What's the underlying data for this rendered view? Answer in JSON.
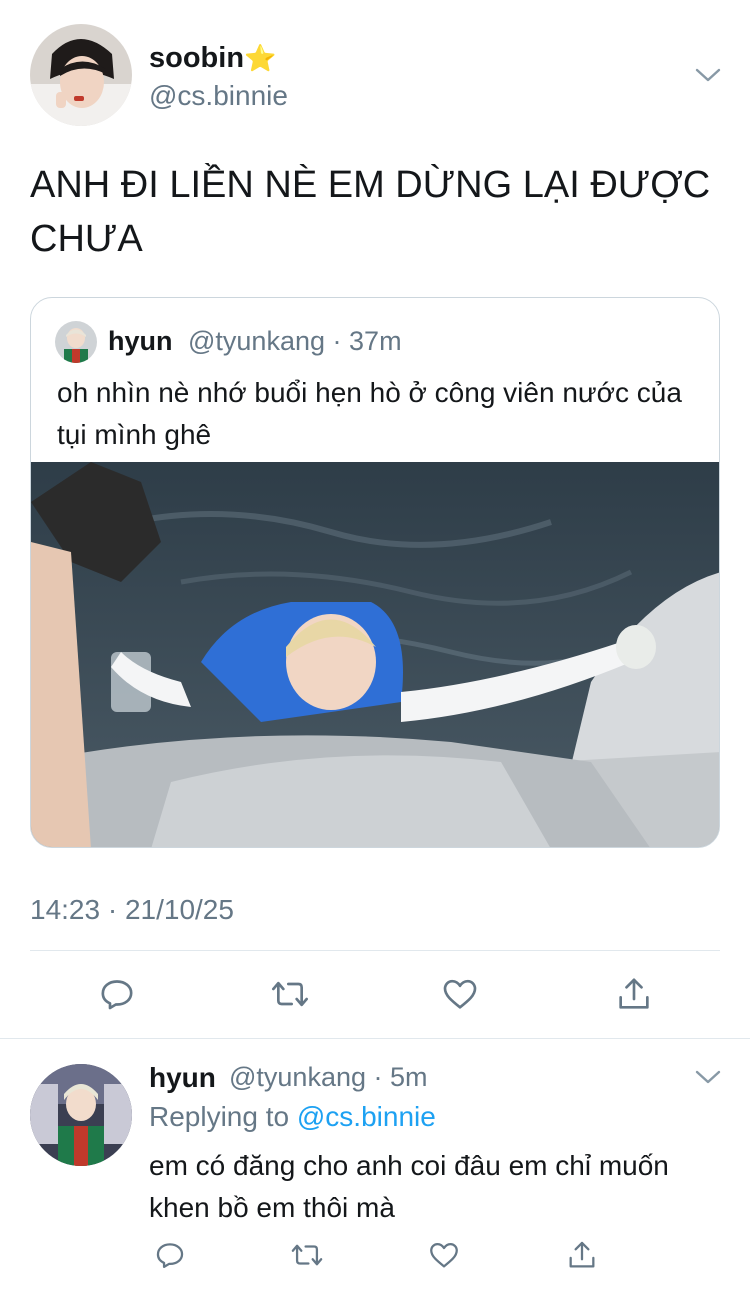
{
  "tweet": {
    "author_name": "soobin",
    "author_badge": "⭐",
    "author_handle": "@cs.binnie",
    "text": "ANH ĐI LIỀN NÈ EM DỪNG LẠI ĐƯỢC CHƯA",
    "timestamp": "14:23 · 21/10/25"
  },
  "quoted": {
    "author_name": "hyun",
    "author_handle": "@tyunkang",
    "separator": "·",
    "age": "37m",
    "text": "oh nhìn nè nhớ buổi hẹn hò ở công viên nước của tụi mình ghê",
    "media_icon": "photo"
  },
  "reply": {
    "author_name": "hyun",
    "author_handle": "@tyunkang",
    "separator": "·",
    "age": "5m",
    "replying_prefix": "Replying to",
    "replying_to": "@cs.binnie",
    "text": "em có đăng cho anh coi đâu em chỉ muốn khen bồ em thôi mà"
  },
  "icons": [
    "chevron-down-icon",
    "reply-icon",
    "retweet-icon",
    "like-icon",
    "share-icon"
  ],
  "colors": {
    "accent": "#1da1f2",
    "secondary_text": "#657786",
    "border": "#ccd6dd",
    "icon": "#657786"
  }
}
